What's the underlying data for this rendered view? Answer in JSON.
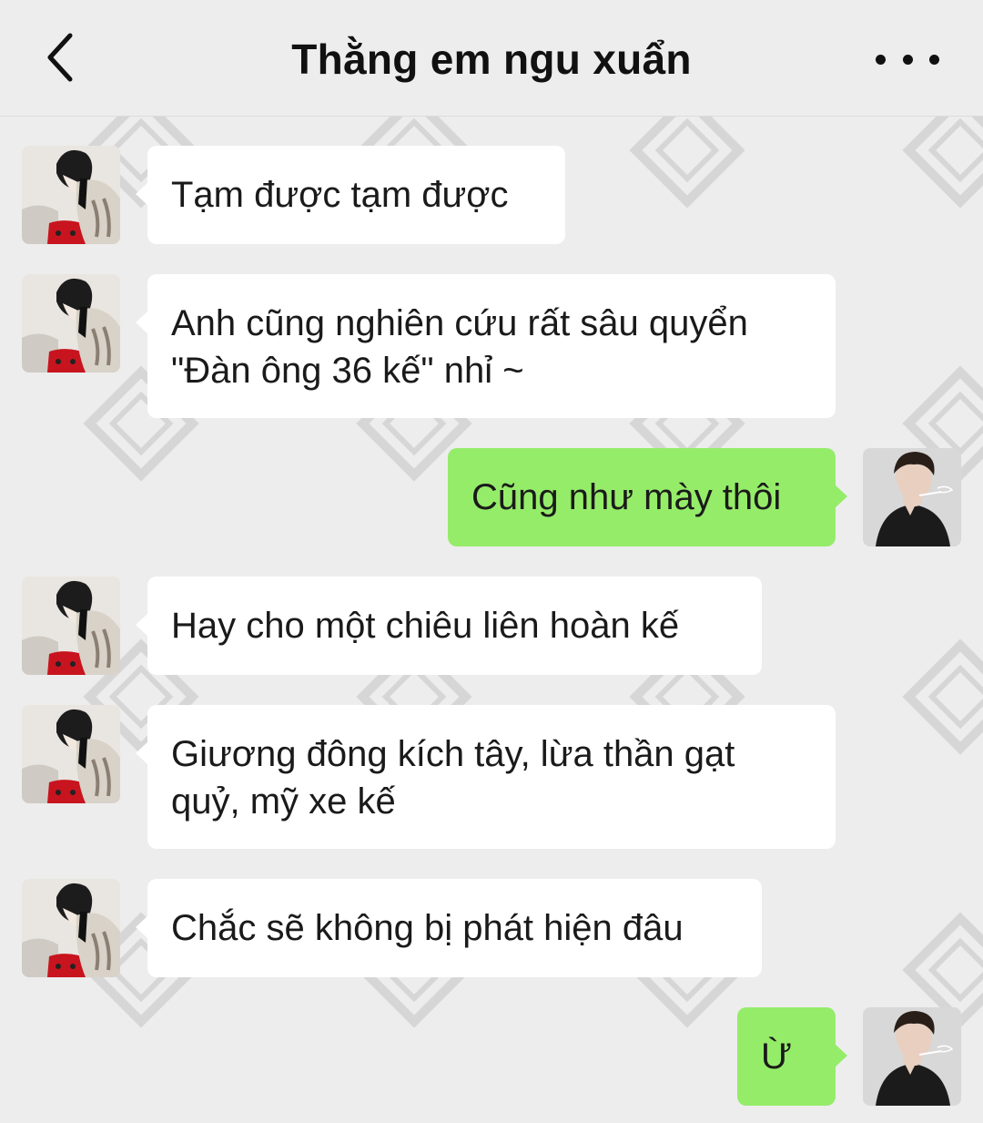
{
  "header": {
    "title": "Thằng em ngu xuẩn",
    "back_icon": "chevron-left-icon",
    "more_icon": "more-dots-icon"
  },
  "messages": [
    {
      "side": "in",
      "text": "Tạm được tạm được"
    },
    {
      "side": "in",
      "text": "Anh cũng nghiên cứu rất sâu quyển \"Đàn ông 36 kế\" nhỉ ~"
    },
    {
      "side": "out",
      "text": "Cũng như mày thôi"
    },
    {
      "side": "in",
      "text": "Hay cho một chiêu liên hoàn kế"
    },
    {
      "side": "in",
      "text": "Giương đông kích tây, lừa thần gạt quỷ, mỹ xe kế"
    },
    {
      "side": "in",
      "text": "Chắc sẽ không bị phát hiện đâu"
    },
    {
      "side": "out",
      "text": "Ừ"
    }
  ],
  "colors": {
    "background": "#ededed",
    "incoming_bubble": "#ffffff",
    "outgoing_bubble": "#95ec69"
  }
}
